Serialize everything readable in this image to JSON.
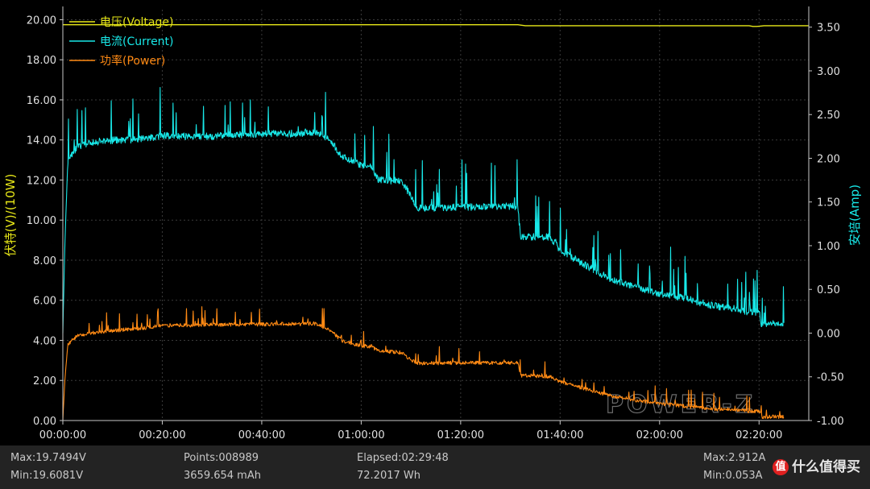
{
  "chart_data": {
    "type": "line",
    "title": "",
    "x": {
      "label": "",
      "min_minutes": 0,
      "max_minutes": 150,
      "ticks": [
        "00:00:00",
        "00:20:00",
        "00:40:00",
        "01:00:00",
        "01:20:00",
        "01:40:00",
        "02:00:00",
        "02:20:00"
      ]
    },
    "y_left": {
      "label": "伏特(V)/(10W)",
      "range": [
        0,
        20
      ],
      "ticks": [
        "0.00",
        "2.00",
        "4.00",
        "6.00",
        "8.00",
        "10.00",
        "12.00",
        "14.00",
        "16.00",
        "18.00",
        "20.00"
      ]
    },
    "y_right": {
      "label": "安培(Amp)",
      "range": [
        -1.0,
        3.7
      ],
      "ticks": [
        "-1.00",
        "-0.50",
        "0.00",
        "0.50",
        "1.00",
        "1.50",
        "2.00",
        "2.50",
        "3.00",
        "3.50"
      ]
    },
    "grid": true,
    "legend_position": "top-left",
    "series": [
      {
        "name": "电压(Voltage)",
        "color": "#e8e818",
        "axis": "left",
        "unit": "V",
        "x_minutes": [
          0,
          92,
          92.5,
          138,
          139,
          141,
          150
        ],
        "values": [
          19.75,
          19.75,
          19.7,
          19.7,
          19.65,
          19.7,
          19.7
        ]
      },
      {
        "name": "电流(Current)",
        "color": "#18e8e8",
        "axis": "right",
        "unit": "A",
        "x_minutes": [
          0,
          0.4,
          1,
          3,
          8,
          16,
          20,
          25,
          30,
          35,
          40,
          45,
          48,
          50.5,
          52,
          54,
          56,
          60,
          62,
          63.5,
          64.5,
          68,
          70.5,
          71,
          80,
          90,
          91.5,
          92,
          98,
          100,
          105,
          110,
          115,
          120,
          125,
          130,
          135,
          138,
          140,
          140.5,
          142,
          145
        ],
        "values": [
          0.0,
          1.0,
          1.98,
          2.14,
          2.2,
          2.22,
          2.26,
          2.25,
          2.25,
          2.27,
          2.28,
          2.28,
          2.28,
          2.3,
          2.27,
          2.2,
          2.02,
          1.92,
          1.9,
          1.75,
          1.75,
          1.74,
          1.53,
          1.43,
          1.44,
          1.45,
          1.45,
          1.1,
          1.1,
          0.95,
          0.78,
          0.62,
          0.53,
          0.45,
          0.4,
          0.32,
          0.28,
          0.24,
          0.24,
          0.1,
          0.1,
          0.12
        ]
      },
      {
        "name": "功率(Power)",
        "color": "#ff8a14",
        "axis": "left",
        "unit": "10W",
        "x_minutes": [
          0,
          0.4,
          1,
          3,
          8,
          16,
          20,
          25,
          30,
          35,
          40,
          45,
          48,
          50.5,
          52,
          54,
          56,
          60,
          62,
          63.5,
          64.5,
          68,
          70.5,
          71,
          80,
          90,
          91.5,
          92,
          98,
          100,
          105,
          110,
          115,
          120,
          125,
          130,
          135,
          138,
          140,
          140.5,
          142,
          145
        ],
        "values": [
          0.0,
          2.0,
          3.8,
          4.25,
          4.45,
          4.6,
          4.75,
          4.75,
          4.78,
          4.8,
          4.8,
          4.82,
          4.8,
          4.85,
          4.7,
          4.45,
          4.0,
          3.72,
          3.7,
          3.45,
          3.45,
          3.4,
          2.95,
          2.85,
          2.88,
          2.88,
          2.88,
          2.25,
          2.2,
          1.95,
          1.58,
          1.25,
          1.02,
          0.85,
          0.72,
          0.6,
          0.52,
          0.45,
          0.45,
          0.18,
          0.18,
          0.2
        ]
      }
    ]
  },
  "stats": {
    "max_voltage": "Max:19.7494V",
    "min_voltage": "Min:19.6081V",
    "points": "Points:008989",
    "capacity": "3659.654 mAh",
    "elapsed": "Elapsed:02:29:48",
    "energy": "72.2017 Wh",
    "max_current": "Max:2.912A",
    "min_current": "Min:0.053A"
  },
  "watermark": {
    "brand_overlay": "POWER-Z",
    "site_badge": "值",
    "site_text": "什么值得买"
  },
  "colors": {
    "background": "#000000",
    "axis": "#c8c8c8",
    "grid": "#3a3a3a",
    "voltage": "#e8e818",
    "current": "#18e8e8",
    "power": "#ff8a14"
  }
}
